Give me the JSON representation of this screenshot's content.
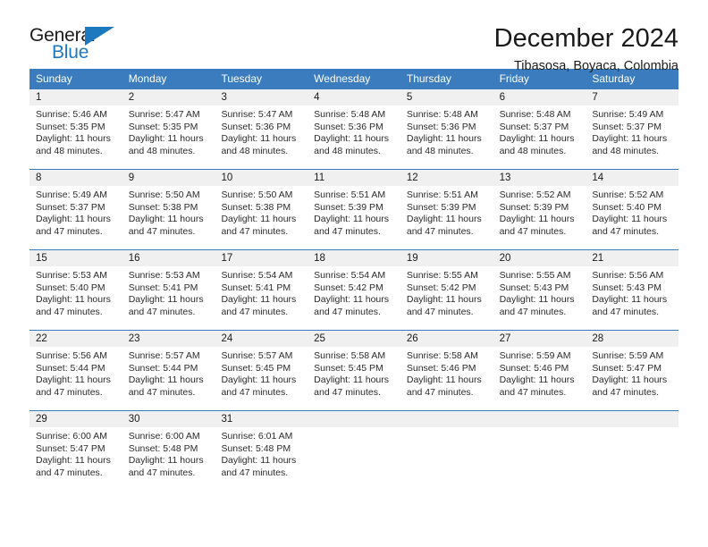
{
  "brand": {
    "name_primary": "General",
    "name_secondary": "Blue"
  },
  "header": {
    "title": "December 2024",
    "location": "Tibasosa, Boyaca, Colombia"
  },
  "colors": {
    "header_blue": "#3a7cbd",
    "logo_blue": "#1c79c0",
    "day_band": "#f0f0f0"
  },
  "weekdays": [
    "Sunday",
    "Monday",
    "Tuesday",
    "Wednesday",
    "Thursday",
    "Friday",
    "Saturday"
  ],
  "weeks": [
    [
      {
        "day": "1",
        "sunrise": "Sunrise: 5:46 AM",
        "sunset": "Sunset: 5:35 PM",
        "daylight": "Daylight: 11 hours and 48 minutes."
      },
      {
        "day": "2",
        "sunrise": "Sunrise: 5:47 AM",
        "sunset": "Sunset: 5:35 PM",
        "daylight": "Daylight: 11 hours and 48 minutes."
      },
      {
        "day": "3",
        "sunrise": "Sunrise: 5:47 AM",
        "sunset": "Sunset: 5:36 PM",
        "daylight": "Daylight: 11 hours and 48 minutes."
      },
      {
        "day": "4",
        "sunrise": "Sunrise: 5:48 AM",
        "sunset": "Sunset: 5:36 PM",
        "daylight": "Daylight: 11 hours and 48 minutes."
      },
      {
        "day": "5",
        "sunrise": "Sunrise: 5:48 AM",
        "sunset": "Sunset: 5:36 PM",
        "daylight": "Daylight: 11 hours and 48 minutes."
      },
      {
        "day": "6",
        "sunrise": "Sunrise: 5:48 AM",
        "sunset": "Sunset: 5:37 PM",
        "daylight": "Daylight: 11 hours and 48 minutes."
      },
      {
        "day": "7",
        "sunrise": "Sunrise: 5:49 AM",
        "sunset": "Sunset: 5:37 PM",
        "daylight": "Daylight: 11 hours and 48 minutes."
      }
    ],
    [
      {
        "day": "8",
        "sunrise": "Sunrise: 5:49 AM",
        "sunset": "Sunset: 5:37 PM",
        "daylight": "Daylight: 11 hours and 47 minutes."
      },
      {
        "day": "9",
        "sunrise": "Sunrise: 5:50 AM",
        "sunset": "Sunset: 5:38 PM",
        "daylight": "Daylight: 11 hours and 47 minutes."
      },
      {
        "day": "10",
        "sunrise": "Sunrise: 5:50 AM",
        "sunset": "Sunset: 5:38 PM",
        "daylight": "Daylight: 11 hours and 47 minutes."
      },
      {
        "day": "11",
        "sunrise": "Sunrise: 5:51 AM",
        "sunset": "Sunset: 5:39 PM",
        "daylight": "Daylight: 11 hours and 47 minutes."
      },
      {
        "day": "12",
        "sunrise": "Sunrise: 5:51 AM",
        "sunset": "Sunset: 5:39 PM",
        "daylight": "Daylight: 11 hours and 47 minutes."
      },
      {
        "day": "13",
        "sunrise": "Sunrise: 5:52 AM",
        "sunset": "Sunset: 5:39 PM",
        "daylight": "Daylight: 11 hours and 47 minutes."
      },
      {
        "day": "14",
        "sunrise": "Sunrise: 5:52 AM",
        "sunset": "Sunset: 5:40 PM",
        "daylight": "Daylight: 11 hours and 47 minutes."
      }
    ],
    [
      {
        "day": "15",
        "sunrise": "Sunrise: 5:53 AM",
        "sunset": "Sunset: 5:40 PM",
        "daylight": "Daylight: 11 hours and 47 minutes."
      },
      {
        "day": "16",
        "sunrise": "Sunrise: 5:53 AM",
        "sunset": "Sunset: 5:41 PM",
        "daylight": "Daylight: 11 hours and 47 minutes."
      },
      {
        "day": "17",
        "sunrise": "Sunrise: 5:54 AM",
        "sunset": "Sunset: 5:41 PM",
        "daylight": "Daylight: 11 hours and 47 minutes."
      },
      {
        "day": "18",
        "sunrise": "Sunrise: 5:54 AM",
        "sunset": "Sunset: 5:42 PM",
        "daylight": "Daylight: 11 hours and 47 minutes."
      },
      {
        "day": "19",
        "sunrise": "Sunrise: 5:55 AM",
        "sunset": "Sunset: 5:42 PM",
        "daylight": "Daylight: 11 hours and 47 minutes."
      },
      {
        "day": "20",
        "sunrise": "Sunrise: 5:55 AM",
        "sunset": "Sunset: 5:43 PM",
        "daylight": "Daylight: 11 hours and 47 minutes."
      },
      {
        "day": "21",
        "sunrise": "Sunrise: 5:56 AM",
        "sunset": "Sunset: 5:43 PM",
        "daylight": "Daylight: 11 hours and 47 minutes."
      }
    ],
    [
      {
        "day": "22",
        "sunrise": "Sunrise: 5:56 AM",
        "sunset": "Sunset: 5:44 PM",
        "daylight": "Daylight: 11 hours and 47 minutes."
      },
      {
        "day": "23",
        "sunrise": "Sunrise: 5:57 AM",
        "sunset": "Sunset: 5:44 PM",
        "daylight": "Daylight: 11 hours and 47 minutes."
      },
      {
        "day": "24",
        "sunrise": "Sunrise: 5:57 AM",
        "sunset": "Sunset: 5:45 PM",
        "daylight": "Daylight: 11 hours and 47 minutes."
      },
      {
        "day": "25",
        "sunrise": "Sunrise: 5:58 AM",
        "sunset": "Sunset: 5:45 PM",
        "daylight": "Daylight: 11 hours and 47 minutes."
      },
      {
        "day": "26",
        "sunrise": "Sunrise: 5:58 AM",
        "sunset": "Sunset: 5:46 PM",
        "daylight": "Daylight: 11 hours and 47 minutes."
      },
      {
        "day": "27",
        "sunrise": "Sunrise: 5:59 AM",
        "sunset": "Sunset: 5:46 PM",
        "daylight": "Daylight: 11 hours and 47 minutes."
      },
      {
        "day": "28",
        "sunrise": "Sunrise: 5:59 AM",
        "sunset": "Sunset: 5:47 PM",
        "daylight": "Daylight: 11 hours and 47 minutes."
      }
    ],
    [
      {
        "day": "29",
        "sunrise": "Sunrise: 6:00 AM",
        "sunset": "Sunset: 5:47 PM",
        "daylight": "Daylight: 11 hours and 47 minutes."
      },
      {
        "day": "30",
        "sunrise": "Sunrise: 6:00 AM",
        "sunset": "Sunset: 5:48 PM",
        "daylight": "Daylight: 11 hours and 47 minutes."
      },
      {
        "day": "31",
        "sunrise": "Sunrise: 6:01 AM",
        "sunset": "Sunset: 5:48 PM",
        "daylight": "Daylight: 11 hours and 47 minutes."
      },
      {
        "day": "",
        "sunrise": "",
        "sunset": "",
        "daylight": ""
      },
      {
        "day": "",
        "sunrise": "",
        "sunset": "",
        "daylight": ""
      },
      {
        "day": "",
        "sunrise": "",
        "sunset": "",
        "daylight": ""
      },
      {
        "day": "",
        "sunrise": "",
        "sunset": "",
        "daylight": ""
      }
    ]
  ]
}
